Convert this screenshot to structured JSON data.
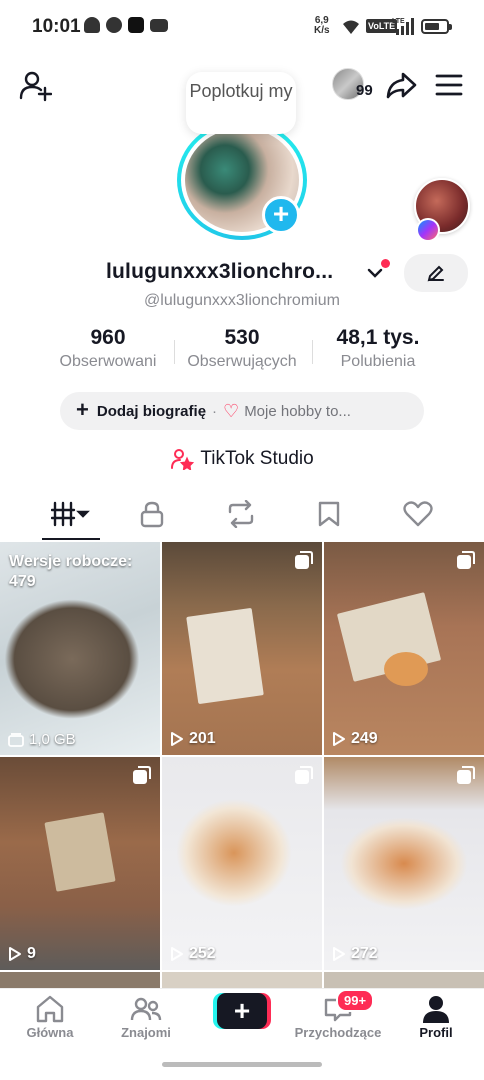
{
  "status_bar": {
    "time": "10:01",
    "net_speed_value": "6,9",
    "net_speed_unit": "K/s",
    "volte": "VoLTE",
    "lte": "LTE"
  },
  "header": {
    "visitors_count": "99",
    "note_text": "Poplotkuj my"
  },
  "profile": {
    "username": "lulugunxxx3lionchro...",
    "handle": "@lulugunxxx3lionchromium",
    "stats": [
      {
        "value": "960",
        "label": "Obserwowani"
      },
      {
        "value": "530",
        "label": "Obserwujących"
      },
      {
        "value": "48,1 tys.",
        "label": "Polubienia"
      }
    ],
    "bio_add": "Dodaj biografię",
    "bio_sep": "·",
    "hobby": "Moje hobby to...",
    "studio": "TikTok Studio"
  },
  "grid": {
    "drafts_label": "Wersje robocze:",
    "drafts_count": "479",
    "drafts_size": "1,0 GB",
    "views": [
      "201",
      "249",
      "9",
      "252",
      "272"
    ]
  },
  "nav": {
    "home": "Główna",
    "friends": "Znajomi",
    "inbox": "Przychodzące",
    "inbox_badge": "99+",
    "profile": "Profil"
  },
  "colors": {
    "accent_pink": "#fe2c55",
    "accent_cyan": "#25f4ee",
    "text": "#161823",
    "secondary": "#8a8b91"
  }
}
